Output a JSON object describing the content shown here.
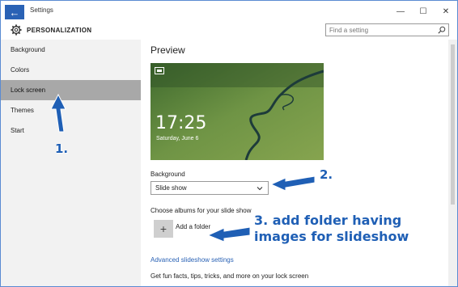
{
  "window": {
    "title": "Settings",
    "controls": {
      "minimize": "—",
      "maximize": "☐",
      "close": "✕"
    },
    "back_glyph": "←"
  },
  "header": {
    "title": "PERSONALIZATION",
    "icon": "gear-icon"
  },
  "search": {
    "placeholder": "Find a setting",
    "value": "",
    "icon": "search-icon"
  },
  "sidebar": {
    "selected_index": 2,
    "items": [
      {
        "label": "Background"
      },
      {
        "label": "Colors"
      },
      {
        "label": "Lock screen"
      },
      {
        "label": "Themes"
      },
      {
        "label": "Start"
      }
    ]
  },
  "main": {
    "preview_title": "Preview",
    "preview": {
      "time": "17:25",
      "date": "Saturday, June 6"
    },
    "background": {
      "label": "Background",
      "selected": "Slide show"
    },
    "albums_label": "Choose albums for your slide show",
    "add_folder": {
      "glyph": "+",
      "label": "Add a folder"
    },
    "advanced_link": "Advanced slideshow settings",
    "fun_facts": "Get fun facts, tips, tricks, and more on your lock screen"
  },
  "annotations": {
    "step1": "1.",
    "step2": "2.",
    "step3_line1": "3. add folder having",
    "step3_line2": "images for slideshow"
  },
  "colors": {
    "accent": "#2a62b5",
    "sidebar_bg": "#f2f2f2",
    "selected_bg": "#a8a8a8",
    "annotation": "#1f5fb5"
  }
}
